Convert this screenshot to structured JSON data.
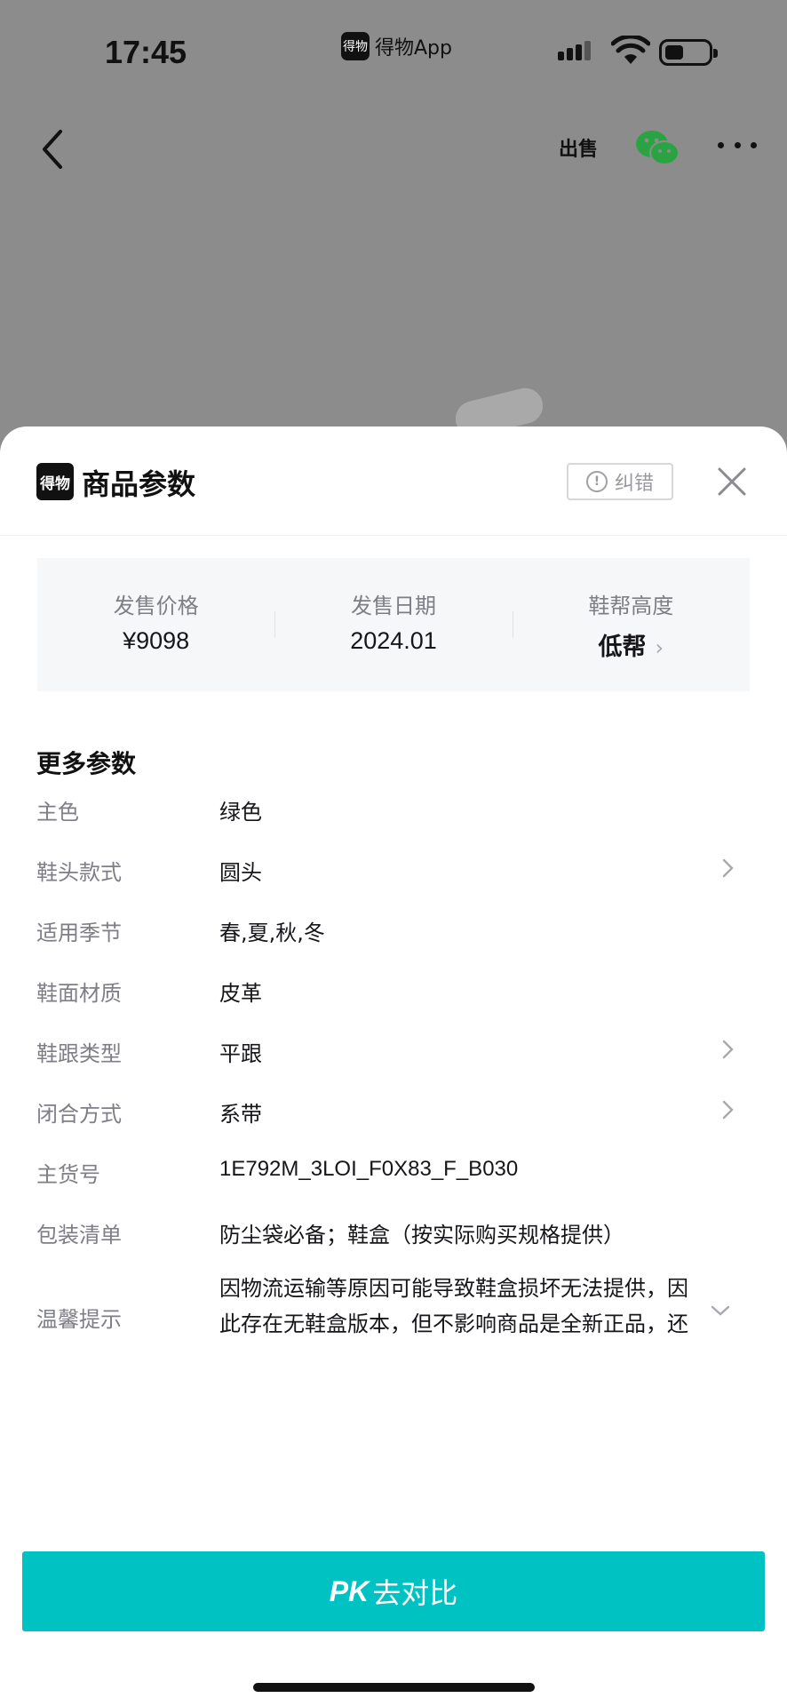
{
  "status_bar": {
    "time": "17:45",
    "app_badge": "得物",
    "app_name": "得物App"
  },
  "top_nav": {
    "sell_label": "出售",
    "icons": [
      "back-icon",
      "sell-icon",
      "wechat-icon",
      "more-icon"
    ]
  },
  "sheet": {
    "logo": "得物",
    "title": "商品参数",
    "report_label": "纠错",
    "summary": [
      {
        "label": "发售价格",
        "value": "¥9098"
      },
      {
        "label": "发售日期",
        "value": "2024.01"
      },
      {
        "label": "鞋帮高度",
        "value": "低帮"
      }
    ],
    "more_title": "更多参数",
    "params": [
      {
        "label": "主色",
        "value": "绿色",
        "has_link": false
      },
      {
        "label": "鞋头款式",
        "value": "圆头",
        "has_link": true
      },
      {
        "label": "适用季节",
        "value": "春,夏,秋,冬",
        "has_link": false
      },
      {
        "label": "鞋面材质",
        "value": "皮革",
        "has_link": false
      },
      {
        "label": "鞋跟类型",
        "value": "平跟",
        "has_link": true
      },
      {
        "label": "闭合方式",
        "value": "系带",
        "has_link": true
      },
      {
        "label": "主货号",
        "value": "1E792M_3LOI_F0X83_F_B030",
        "has_link": false
      },
      {
        "label": "包装清单",
        "value": "防尘袋必备；鞋盒（按实际购买规格提供）",
        "has_link": false
      },
      {
        "label": "温馨提示",
        "value": "因物流运输等原因可能导致鞋盒损坏无法提供，因此存在无鞋盒版本，但不影响商品是全新正品，还",
        "expandable": true
      }
    ],
    "pk_prefix": "PK",
    "pk_label": "去对比"
  },
  "colors": {
    "accent": "#01c2c3",
    "overlay": "#8c8c8c",
    "label_gray": "#7e7e86"
  }
}
